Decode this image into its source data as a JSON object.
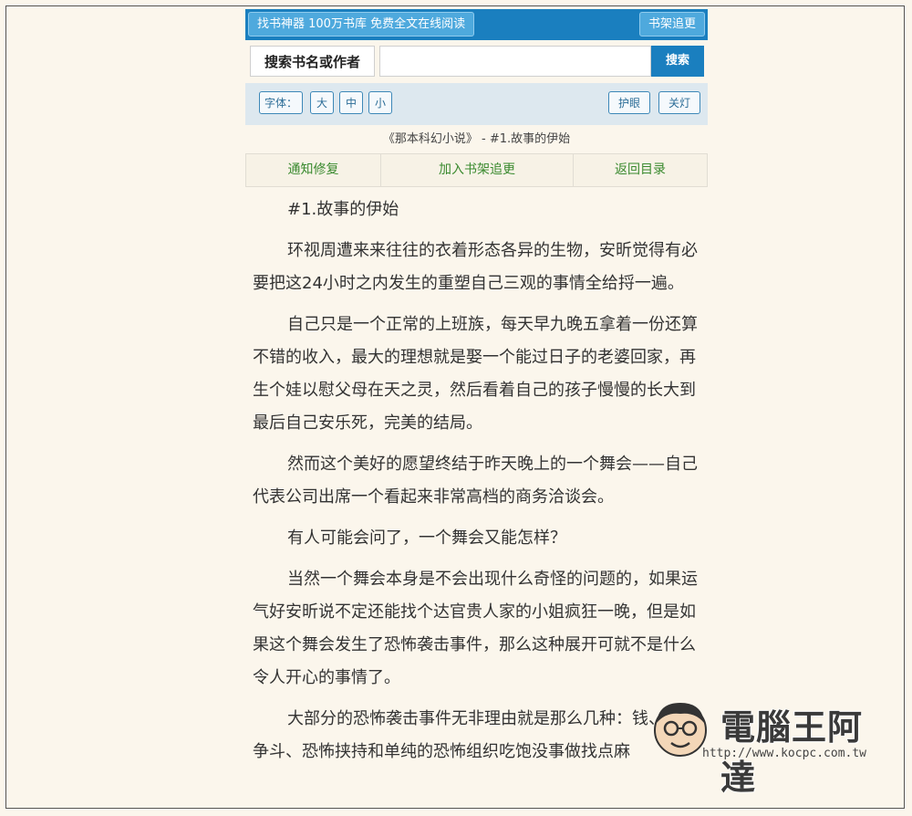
{
  "topbar": {
    "left_label": "找书神器 100万书库 免费全文在线阅读",
    "right_label": "书架追更"
  },
  "search": {
    "label": "搜索书名或作者",
    "value": "",
    "button_label": "搜索"
  },
  "toolbar": {
    "font_label": "字体：",
    "font_large": "大",
    "font_medium": "中",
    "font_small": "小",
    "eye_care": "护眼",
    "lights_off": "关灯"
  },
  "chapter_title": "《那本科幻小说》 - #1.故事的伊始",
  "nav": {
    "report": "通知修复",
    "add_shelf": "加入书架追更",
    "back": "返回目录"
  },
  "content": {
    "paragraphs": [
      "#1.故事的伊始",
      "环视周遭来来往往的衣着形态各异的生物，安昕觉得有必要把这24小时之内发生的重塑自己三观的事情全给捋一遍。",
      "自己只是一个正常的上班族，每天早九晚五拿着一份还算不错的收入，最大的理想就是娶一个能过日子的老婆回家，再生个娃以慰父母在天之灵，然后看着自己的孩子慢慢的长大到最后自己安乐死，完美的结局。",
      "然而这个美好的愿望终结于昨天晚上的一个舞会——自己代表公司出席一个看起来非常高档的商务洽谈会。",
      "有人可能会问了，一个舞会又能怎样？",
      "当然一个舞会本身是不会出现什么奇怪的问题的，如果运气好安昕说不定还能找个达官贵人家的小姐疯狂一晚，但是如果这个舞会发生了恐怖袭击事件，那么这种展开可就不是什么令人开心的事情了。",
      "大部分的恐怖袭击事件无非理由就是那么几种：钱、权利争斗、恐怖挟持和单纯的恐怖组织吃饱没事做找点麻"
    ]
  },
  "watermark": {
    "text": "電腦王阿達",
    "url": "http://www.kocpc.com.tw"
  }
}
